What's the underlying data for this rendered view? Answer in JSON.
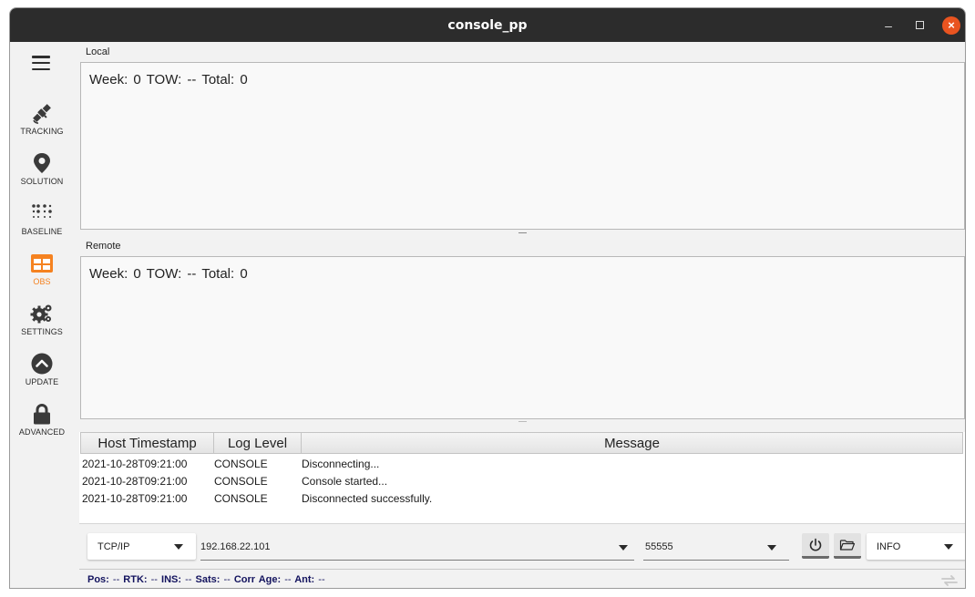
{
  "window": {
    "title": "console_pp",
    "minimize": "–",
    "close": "×"
  },
  "sidebar": {
    "items": [
      {
        "label": "TRACKING",
        "icon": "satellite-icon",
        "active": false
      },
      {
        "label": "SOLUTION",
        "icon": "map-pin-icon",
        "active": false
      },
      {
        "label": "BASELINE",
        "icon": "dots-grid-icon",
        "active": false
      },
      {
        "label": "OBS",
        "icon": "table-icon",
        "active": true
      },
      {
        "label": "SETTINGS",
        "icon": "gears-icon",
        "active": false
      },
      {
        "label": "UPDATE",
        "icon": "chevron-up-circle-icon",
        "active": false
      },
      {
        "label": "ADVANCED",
        "icon": "lock-icon",
        "active": false
      }
    ]
  },
  "local": {
    "label": "Local",
    "stats": "Week:  0  TOW:  --  Total:  0"
  },
  "remote": {
    "label": "Remote",
    "stats": "Week:  0  TOW:  --  Total:  0"
  },
  "log": {
    "headers": [
      "Host Timestamp",
      "Log Level",
      "Message"
    ],
    "rows": [
      {
        "timestamp": "2021-10-28T09:21:00",
        "level": "CONSOLE",
        "message": "Disconnecting..."
      },
      {
        "timestamp": "2021-10-28T09:21:00",
        "level": "CONSOLE",
        "message": "Console started..."
      },
      {
        "timestamp": "2021-10-28T09:21:00",
        "level": "CONSOLE",
        "message": "Disconnected successfully."
      }
    ]
  },
  "toolbar": {
    "connection_type": "TCP/IP",
    "host": "192.168.22.101",
    "port": "55555",
    "log_level": "INFO",
    "power_icon": "power-icon",
    "folder_icon": "folder-open-icon"
  },
  "status": {
    "pos_label": "Pos:",
    "pos_value": "--",
    "rtk_label": "RTK:",
    "rtk_value": "--",
    "ins_label": "INS:",
    "ins_value": "--",
    "sats_label": "Sats:",
    "sats_value": "--",
    "corr_label": "Corr Age:",
    "corr_value": "--",
    "ant_label": "Ant:",
    "ant_value": "--"
  },
  "colors": {
    "accent": "#f58220",
    "titlebar": "#2c2c2c",
    "close": "#e95420",
    "status_text": "#13135e"
  }
}
